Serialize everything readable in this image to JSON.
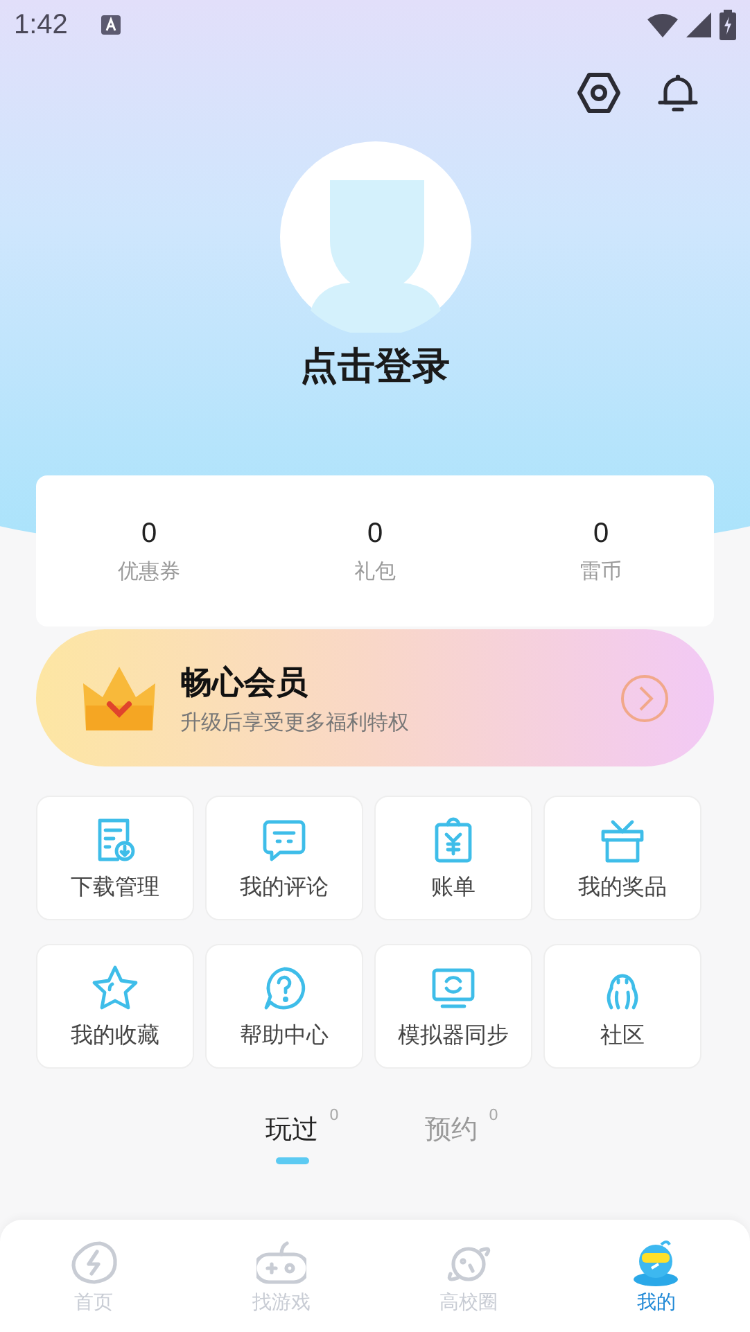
{
  "status_bar": {
    "time": "1:42"
  },
  "profile": {
    "login_label": "点击登录"
  },
  "stats": [
    {
      "value": "0",
      "label": "优惠券"
    },
    {
      "value": "0",
      "label": "礼包"
    },
    {
      "value": "0",
      "label": "雷币"
    }
  ],
  "membership": {
    "title": "畅心会员",
    "subtitle": "升级后享受更多福利特权"
  },
  "shortcuts": [
    {
      "label": "下载管理"
    },
    {
      "label": "我的评论"
    },
    {
      "label": "账单"
    },
    {
      "label": "我的奖品"
    },
    {
      "label": "我的收藏"
    },
    {
      "label": "帮助中心"
    },
    {
      "label": "模拟器同步"
    },
    {
      "label": "社区"
    }
  ],
  "tabs": [
    {
      "label": "玩过",
      "count": "0",
      "selected": true
    },
    {
      "label": "预约",
      "count": "0",
      "selected": false
    }
  ],
  "bottom_nav": [
    {
      "label": "首页",
      "selected": false
    },
    {
      "label": "找游戏",
      "selected": false
    },
    {
      "label": "高校圈",
      "selected": false
    },
    {
      "label": "我的",
      "selected": true
    }
  ]
}
